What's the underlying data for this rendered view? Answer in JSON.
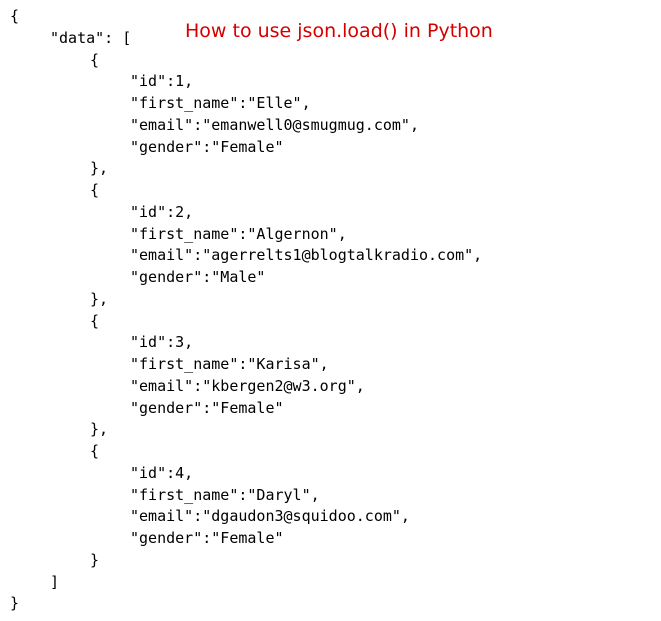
{
  "title": "How to use json.load() in Python",
  "syntax": {
    "brace_open": "{",
    "brace_close": "}",
    "bracket_open": "[",
    "bracket_close": "]"
  },
  "code": {
    "data_key": "\"data\": [",
    "record_open": "{",
    "record_close": "},",
    "record_close_last": "}",
    "records": [
      {
        "l1": "\"id\":1,",
        "l2": "\"first_name\":\"Elle\",",
        "l3": "\"email\":\"emanwell0@smugmug.com\",",
        "l4": "\"gender\":\"Female\""
      },
      {
        "l1": "\"id\":2,",
        "l2": "\"first_name\":\"Algernon\",",
        "l3": "\"email\":\"agerrelts1@blogtalkradio.com\",",
        "l4": "\"gender\":\"Male\""
      },
      {
        "l1": "\"id\":3,",
        "l2": "\"first_name\":\"Karisa\",",
        "l3": "\"email\":\"kbergen2@w3.org\",",
        "l4": "\"gender\":\"Female\""
      },
      {
        "l1": "\"id\":4,",
        "l2": "\"first_name\":\"Daryl\",",
        "l3": "\"email\":\"dgaudon3@squidoo.com\",",
        "l4": "\"gender\":\"Female\""
      }
    ]
  }
}
